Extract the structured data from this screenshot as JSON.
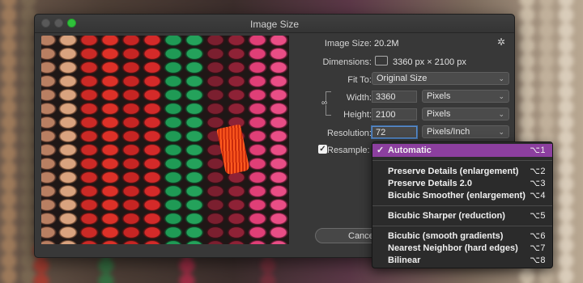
{
  "window": {
    "title": "Image Size"
  },
  "info": {
    "image_size_label": "Image Size:",
    "image_size_value": "20.2M",
    "dimensions_label": "Dimensions:",
    "dimensions_value": "3360 px  ×  2100 px"
  },
  "fit_to": {
    "label": "Fit To:",
    "value": "Original Size"
  },
  "width": {
    "label": "Width:",
    "value": "3360",
    "unit": "Pixels"
  },
  "height": {
    "label": "Height:",
    "value": "2100",
    "unit": "Pixels"
  },
  "resolution": {
    "label": "Resolution:",
    "value": "72",
    "unit": "Pixels/Inch"
  },
  "resample": {
    "label": "Resample:",
    "checked": true,
    "check_glyph": "✓"
  },
  "buttons": {
    "cancel": "Cancel"
  },
  "resample_menu": {
    "check_glyph": "✓",
    "selected_color": "#8c3f9f",
    "items": [
      {
        "label": "Automatic",
        "shortcut": "⌥1"
      },
      {
        "label": "Preserve Details (enlargement)",
        "shortcut": "⌥2"
      },
      {
        "label": "Preserve Details 2.0",
        "shortcut": "⌥3"
      },
      {
        "label": "Bicubic Smoother (enlargement)",
        "shortcut": "⌥4"
      },
      {
        "label": "Bicubic Sharper (reduction)",
        "shortcut": "⌥5"
      },
      {
        "label": "Bicubic (smooth gradients)",
        "shortcut": "⌥6"
      },
      {
        "label": "Nearest Neighbor (hard edges)",
        "shortcut": "⌥7"
      },
      {
        "label": "Bilinear",
        "shortcut": "⌥8"
      }
    ]
  },
  "icons": {
    "gear": "gear-icon",
    "link": "link-icon",
    "dimensions": "dimensions-icon",
    "chevron": "chevron-updown-icon"
  }
}
